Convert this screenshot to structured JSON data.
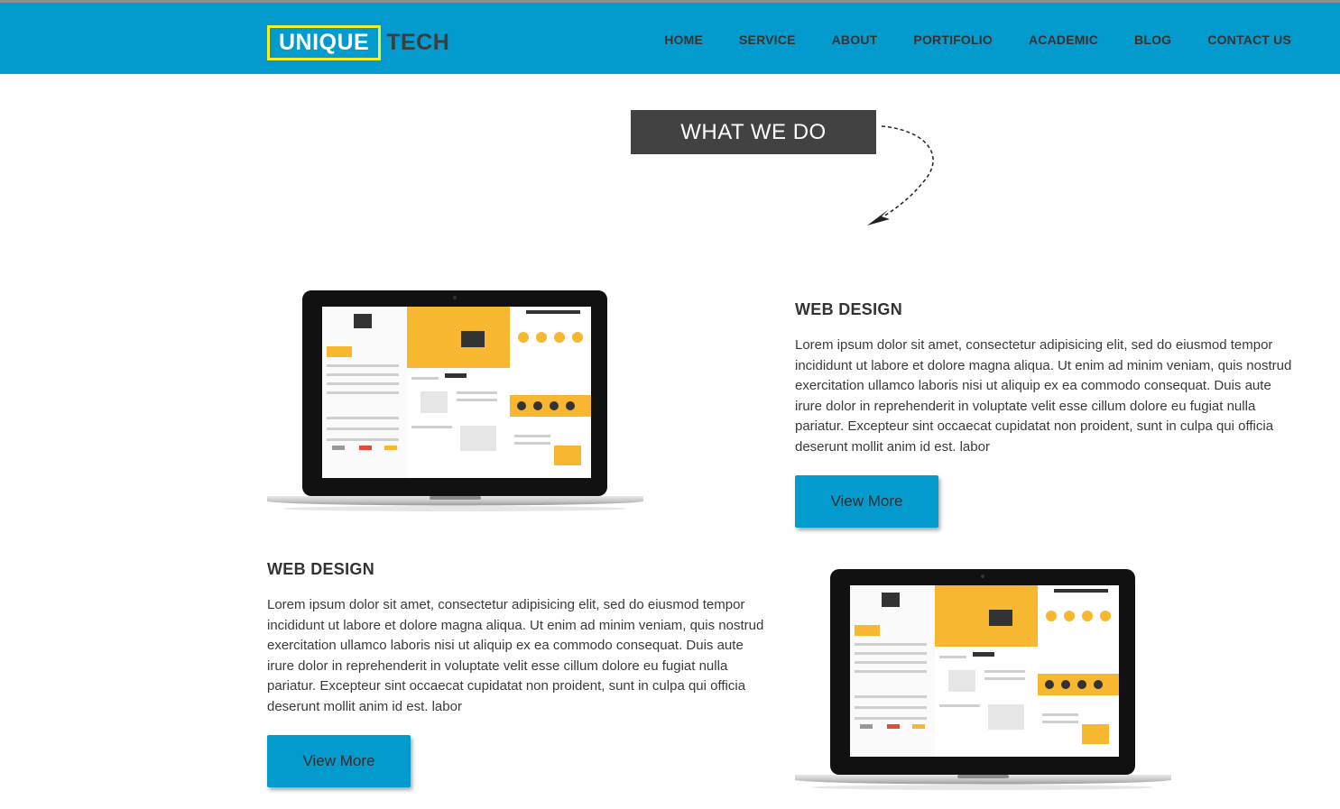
{
  "header": {
    "logo_primary": "UNIQUE",
    "logo_secondary": "TECH",
    "nav": [
      "HOME",
      "SERVICE",
      "ABOUT",
      "PORTIFOLIO",
      "ACADEMIC",
      "BLOG",
      "CONTACT US"
    ]
  },
  "section": {
    "banner": "WHAT WE DO"
  },
  "features": [
    {
      "title": "WEB DESIGN",
      "text": "Lorem ipsum dolor sit amet, consectetur adipisicing elit, sed do eiusmod tempor incididunt ut labore et dolore magna aliqua. Ut enim ad minim veniam, quis nostrud exercitation ullamco laboris nisi ut aliquip ex ea commodo consequat. Duis aute irure dolor in reprehenderit in voluptate velit esse cillum dolore eu fugiat nulla pariatur. Excepteur sint occaecat cupidatat non proident, sunt in culpa qui officia deserunt mollit anim id est. labor",
      "button": "View More"
    },
    {
      "title": "WEB DESIGN",
      "text": "Lorem ipsum dolor sit amet, consectetur adipisicing elit, sed do eiusmod tempor incididunt ut labore et dolore magna aliqua. Ut enim ad minim veniam, quis nostrud exercitation ullamco laboris nisi ut aliquip ex ea commodo consequat. Duis aute irure dolor in reprehenderit in voluptate velit esse cillum dolore eu fugiat nulla pariatur. Excepteur sint occaecat cupidatat non proident, sunt in culpa qui officia deserunt mollit anim id est. labor",
      "button": "View More"
    }
  ],
  "colors": {
    "brand_blue": "#039bcd",
    "logo_border": "#f4ef25",
    "banner_bg": "#424242",
    "screen_accent": "#f7b731"
  },
  "icons": [
    "dashed-arrow-icon",
    "laptop-mockup"
  ]
}
